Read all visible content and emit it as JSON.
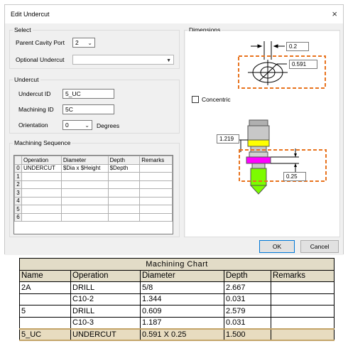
{
  "dialog": {
    "title": "Edit Undercut",
    "close_glyph": "×",
    "select": {
      "label": "Select",
      "parent_cavity_port_label": "Parent Cavity Port",
      "parent_cavity_port_value": "2",
      "optional_undercut_label": "Optional Undercut",
      "optional_undercut_value": ""
    },
    "undercut": {
      "label": "Undercut",
      "id_label": "Undercut ID",
      "id_value": "5_UC",
      "machining_id_label": "Machining ID",
      "machining_id_value": "5C",
      "orientation_label": "Orientation",
      "orientation_value": "0",
      "orientation_unit": "Degrees"
    },
    "machining_sequence": {
      "label": "Machining Sequence",
      "columns": [
        "Operation",
        "Diameter",
        "Depth",
        "Remarks"
      ],
      "row_numbers": [
        "0",
        "1",
        "2",
        "3",
        "4",
        "5",
        "6"
      ],
      "rows": [
        [
          "UNDERCUT",
          "$Dia x $Height",
          "$Depth",
          ""
        ]
      ]
    },
    "dimensions": {
      "label": "Dimensions",
      "top_value": "0.2",
      "diameter_value": "0.591",
      "concentric_label": "Concentric",
      "side_value": "1.219",
      "height_value": "0.25"
    },
    "ok_label": "OK",
    "cancel_label": "Cancel"
  },
  "machining_chart": {
    "title": "Machining Chart",
    "columns": [
      "Name",
      "Operation",
      "Diameter",
      "Depth",
      "Remarks"
    ],
    "rows": [
      [
        "2A",
        "DRILL",
        "5/8",
        "2.667",
        ""
      ],
      [
        "",
        "C10-2",
        "1.344",
        "0.031",
        ""
      ],
      [
        "5",
        "DRILL",
        "0.609",
        "2.579",
        ""
      ],
      [
        "",
        "C10-3",
        "1.187",
        "0.031",
        ""
      ],
      [
        "5_UC",
        "UNDERCUT",
        "0.591 X 0.25",
        "1.500",
        ""
      ]
    ],
    "highlight_row": 4
  },
  "colors": {
    "accent_orange": "#e8731e",
    "gold_body": "#ffff00",
    "magenta_undercut": "#ff00ff",
    "green_tip": "#7cfc00",
    "chart_header": "#e2dcc7"
  }
}
